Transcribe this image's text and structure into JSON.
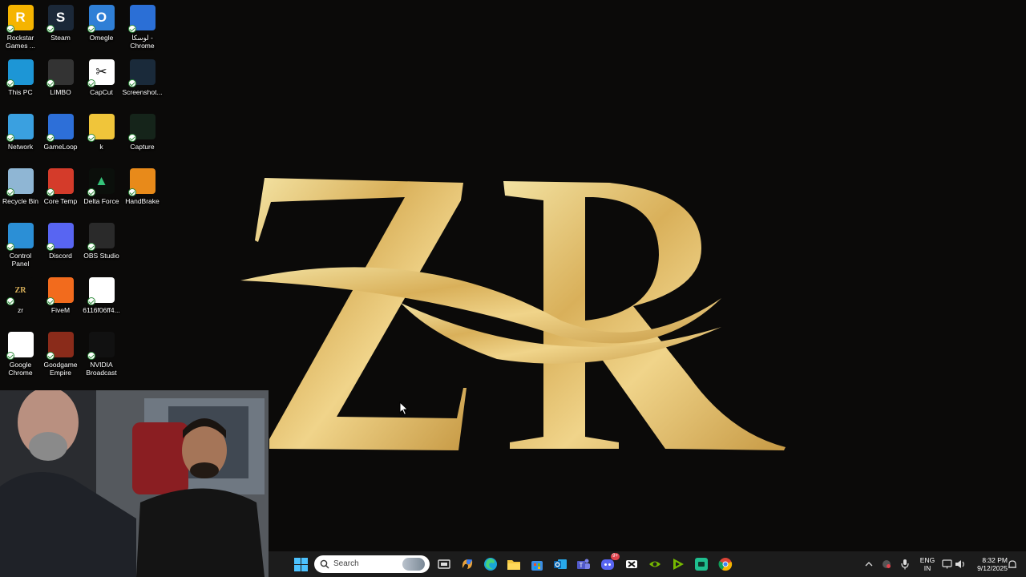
{
  "desktop": {
    "wallpaper_logo": "ZR",
    "icons": [
      {
        "label": "Rockstar Games ...",
        "icon": "rockstar-icon",
        "glyph": "R",
        "color": "#f5b400"
      },
      {
        "label": "Steam",
        "icon": "steam-icon",
        "glyph": "S",
        "color": "#1b2838"
      },
      {
        "label": "Omegle",
        "icon": "omegle-icon",
        "glyph": "O",
        "color": "#2f7fd6"
      },
      {
        "label": "لوسكا - Chrome",
        "icon": "chrome-icon",
        "glyph": "",
        "color": "#2b6fd6"
      },
      {
        "label": "This PC",
        "icon": "this-pc-icon",
        "glyph": "",
        "color": "#1d96d6"
      },
      {
        "label": "LIMBO",
        "icon": "limbo-icon",
        "glyph": "",
        "color": "#333333"
      },
      {
        "label": "CapCut",
        "icon": "capcut-icon",
        "glyph": "✂",
        "color": "#ffffff"
      },
      {
        "label": "Screenshot...",
        "icon": "screenshot-file-icon",
        "glyph": "",
        "color": "#1a2a3a"
      },
      {
        "label": "Network",
        "icon": "network-icon",
        "glyph": "",
        "color": "#3aa0e0"
      },
      {
        "label": "GameLoop",
        "icon": "gameloop-icon",
        "glyph": "",
        "color": "#2d6fd8"
      },
      {
        "label": "k",
        "icon": "folder-icon",
        "glyph": "",
        "color": "#f0c53a"
      },
      {
        "label": "Capture",
        "icon": "capture-file-icon",
        "glyph": "",
        "color": "#15241a"
      },
      {
        "label": "Recycle Bin",
        "icon": "recycle-bin-icon",
        "glyph": "",
        "color": "#8fb6d4"
      },
      {
        "label": "Core Temp",
        "icon": "core-temp-icon",
        "glyph": "",
        "color": "#d43b2a"
      },
      {
        "label": "Delta Force",
        "icon": "delta-force-icon",
        "glyph": "▲",
        "color": "#0b0f0b"
      },
      {
        "label": "HandBrake",
        "icon": "handbrake-icon",
        "glyph": "",
        "color": "#e88a1a"
      },
      {
        "label": "Control Panel",
        "icon": "control-panel-icon",
        "glyph": "",
        "color": "#2b8fd6"
      },
      {
        "label": "Discord",
        "icon": "discord-icon",
        "glyph": "",
        "color": "#5865f2"
      },
      {
        "label": "OBS Studio",
        "icon": "obs-studio-icon",
        "glyph": "",
        "color": "#2a2a2a"
      },
      {
        "label": "",
        "icon": "",
        "glyph": "",
        "color": ""
      },
      {
        "label": "zr",
        "icon": "zr-file-icon",
        "glyph": "ZR",
        "color": "#0b0a09"
      },
      {
        "label": "FiveM",
        "icon": "fivem-icon",
        "glyph": "",
        "color": "#f26b1d"
      },
      {
        "label": "6116f06ff4...",
        "icon": "image-file-icon",
        "glyph": "",
        "color": "#ffffff"
      },
      {
        "label": "",
        "icon": "",
        "glyph": "",
        "color": ""
      },
      {
        "label": "Google Chrome",
        "icon": "google-chrome-icon",
        "glyph": "",
        "color": "#ffffff"
      },
      {
        "label": "Goodgame Empire",
        "icon": "goodgame-empire-icon",
        "glyph": "",
        "color": "#8a2b1a"
      },
      {
        "label": "NVIDIA Broadcast",
        "icon": "nvidia-broadcast-icon",
        "glyph": "",
        "color": "#111111"
      }
    ]
  },
  "taskbar": {
    "search_placeholder": "Search",
    "pinned": [
      "task-view-icon",
      "copilot-icon",
      "edge-icon",
      "file-explorer-icon",
      "microsoft-store-icon",
      "outlook-icon",
      "teams-icon",
      "discord-taskbar-icon",
      "capcut-taskbar-icon",
      "nvidia-icon",
      "nvidia-broadcast-taskbar-icon",
      "app-icon",
      "chrome-taskbar-icon"
    ],
    "discord_badge": "9+",
    "language_line1": "ENG",
    "language_line2": "IN",
    "time": "8:32 PM",
    "date": "9/12/2025"
  }
}
